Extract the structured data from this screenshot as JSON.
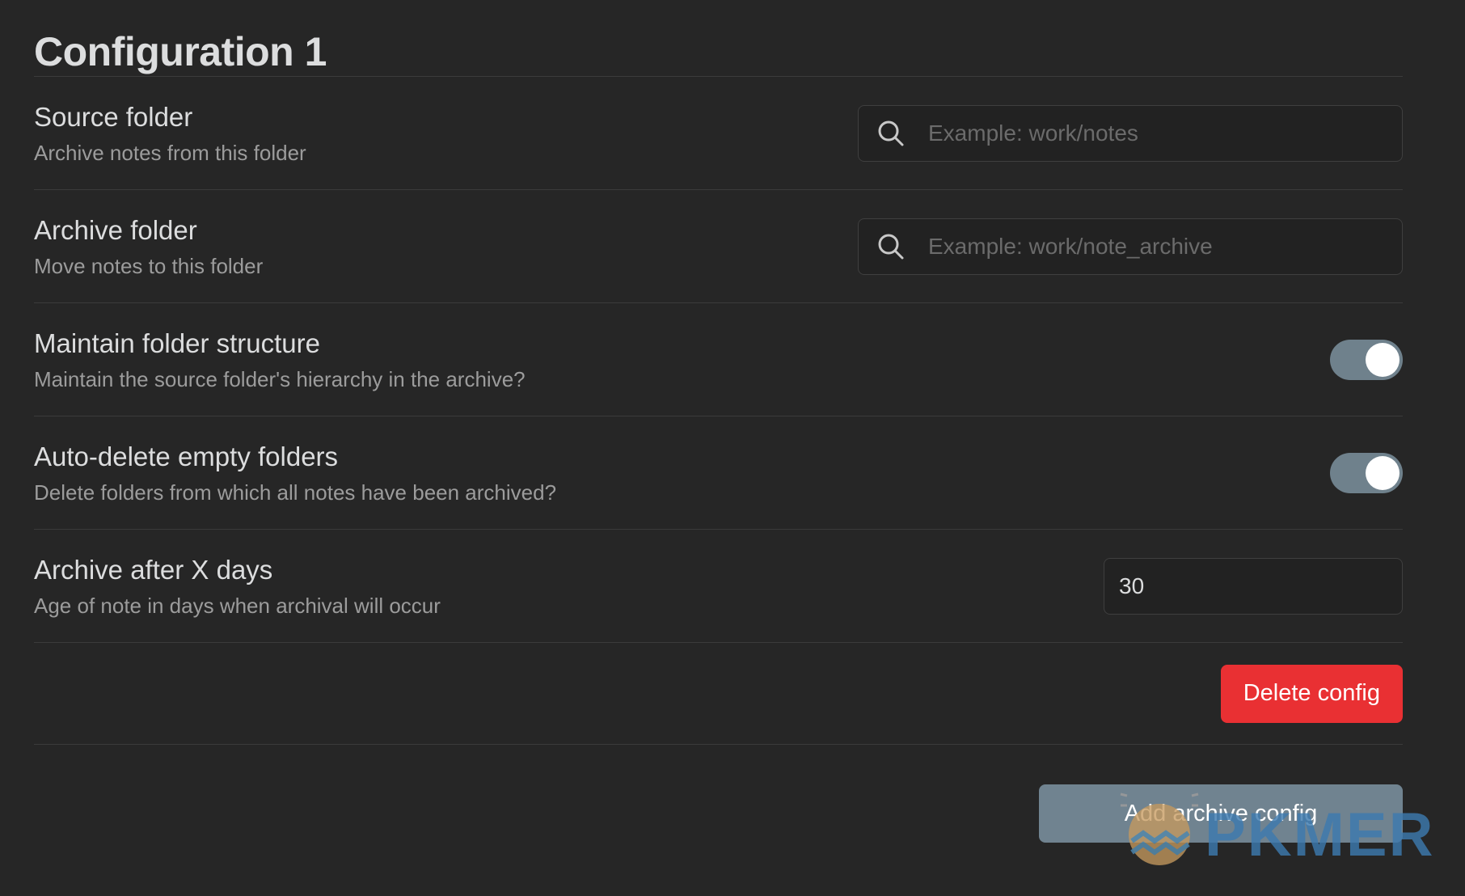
{
  "config": {
    "title": "Configuration 1"
  },
  "settings": {
    "source_folder": {
      "name": "Source folder",
      "desc": "Archive notes from this folder",
      "placeholder": "Example: work/notes",
      "value": ""
    },
    "archive_folder": {
      "name": "Archive folder",
      "desc": "Move notes to this folder",
      "placeholder": "Example: work/note_archive",
      "value": ""
    },
    "maintain_structure": {
      "name": "Maintain folder structure",
      "desc": "Maintain the source folder's hierarchy in the archive?",
      "enabled": true
    },
    "auto_delete": {
      "name": "Auto-delete empty folders",
      "desc": "Delete folders from which all notes have been archived?",
      "enabled": true
    },
    "archive_days": {
      "name": "Archive after X days",
      "desc": "Age of note in days when archival will occur",
      "value": "30"
    }
  },
  "actions": {
    "delete_label": "Delete config",
    "add_label": "Add archive config"
  },
  "watermark": {
    "text": "PKMER"
  },
  "icons": {
    "search": "search-icon",
    "watermark_logo": "pkmer-logo-icon"
  },
  "colors": {
    "background": "#262626",
    "accent_toggle": "#6f818c",
    "danger": "#e93033",
    "add_button": "#708390"
  }
}
